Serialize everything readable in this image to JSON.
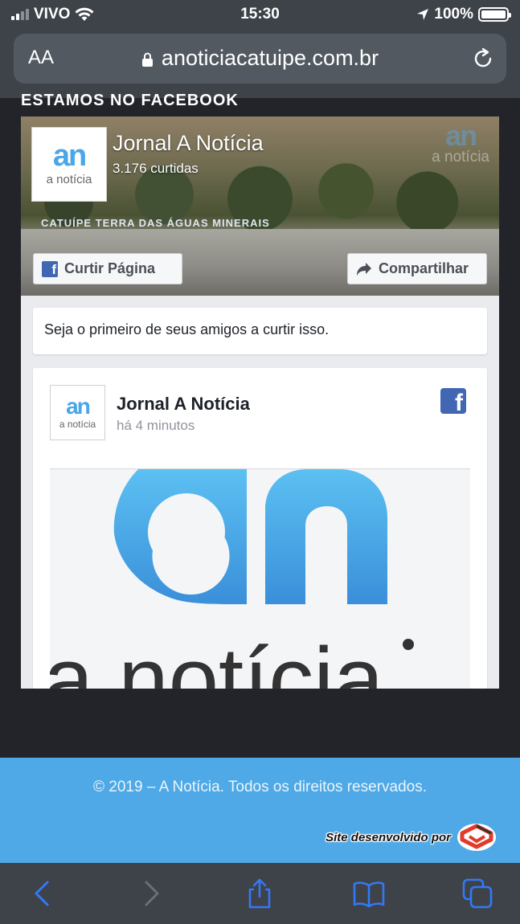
{
  "status_bar": {
    "carrier": "VIVO",
    "time": "15:30",
    "battery": "100%"
  },
  "browser": {
    "text_size_label": "AA",
    "url": "anoticiacatuipe.com.br"
  },
  "page": {
    "section_title": "ESTAMOS NO FACEBOOK",
    "fb_page": {
      "cover_sign": "CATUÍPE TERRA DAS ÁGUAS MINERAIS",
      "logo_mark": "an",
      "logo_word": "a notícia",
      "name": "Jornal A Notícia",
      "likes": "3.176 curtidas",
      "like_button": "Curtir Página",
      "share_button": "Compartilhar",
      "friends_text": "Seja o primeiro de seus amigos a curtir isso."
    },
    "post": {
      "author": "Jornal A Notícia",
      "time": "há 4 minutos",
      "image_logo_mark": "an",
      "image_logo_word": "a notícia"
    }
  },
  "footer": {
    "copyright": "© 2019 –  A Notícia.  Todos os direitos reservados.",
    "dev_credit": "Site desenvolvido por"
  },
  "toolbar": {
    "icons": [
      "back-icon",
      "forward-icon",
      "share-icon",
      "bookmarks-icon",
      "tabs-icon"
    ]
  },
  "colors": {
    "facebook_blue": "#4267b2",
    "brand_blue": "#4fa9e6",
    "ios_link_blue": "#3478f6"
  }
}
